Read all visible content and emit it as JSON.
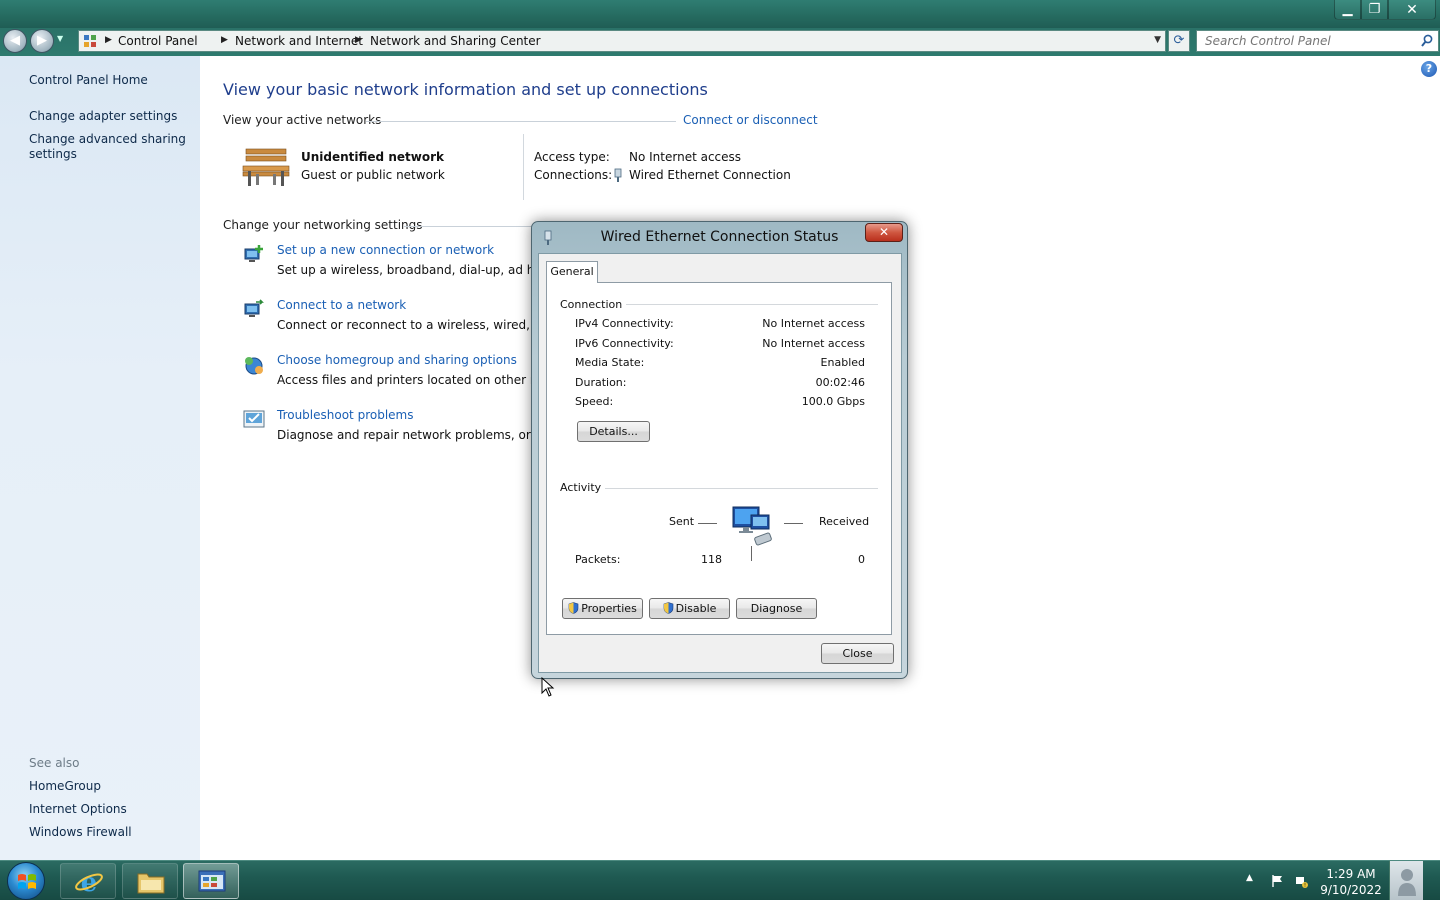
{
  "window": {
    "controls": {
      "minimize": "▁",
      "maximize": "❐",
      "close": "✕"
    }
  },
  "address_bar": {
    "breadcrumbs": [
      "Control Panel",
      "Network and Internet",
      "Network and Sharing Center"
    ],
    "search_placeholder": "Search Control Panel"
  },
  "left_pane": {
    "home_link": "Control Panel Home",
    "links": [
      "Change adapter settings",
      "Change advanced sharing settings"
    ],
    "see_also_label": "See also",
    "see_also_links": [
      "HomeGroup",
      "Internet Options",
      "Windows Firewall"
    ]
  },
  "main": {
    "heading": "View your basic network information and set up connections",
    "active_networks_label": "View your active networks",
    "connect_disconnect_link": "Connect or disconnect",
    "network": {
      "name": "Unidentified network",
      "type": "Guest or public network",
      "access_type_label": "Access type:",
      "access_type_value": "No Internet access",
      "connections_label": "Connections:",
      "connections_value": "Wired Ethernet Connection"
    },
    "settings_label": "Change your networking settings",
    "tasks": [
      {
        "title": "Set up a new connection or network",
        "desc": "Set up a wireless, broadband, dial-up, ad hoc, or V"
      },
      {
        "title": "Connect to a network",
        "desc": "Connect or reconnect to a wireless, wired, dial-up"
      },
      {
        "title": "Choose homegroup and sharing options",
        "desc": "Access files and printers located on other network"
      },
      {
        "title": "Troubleshoot problems",
        "desc": "Diagnose and repair network problems, or get tro"
      }
    ]
  },
  "dialog": {
    "title": "Wired Ethernet Connection Status",
    "close_glyph": "✕",
    "tab": "General",
    "connection_group": "Connection",
    "fields": [
      {
        "label": "IPv4 Connectivity:",
        "value": "No Internet access"
      },
      {
        "label": "IPv6 Connectivity:",
        "value": "No Internet access"
      },
      {
        "label": "Media State:",
        "value": "Enabled"
      },
      {
        "label": "Duration:",
        "value": "00:02:46"
      },
      {
        "label": "Speed:",
        "value": "100.0 Gbps"
      }
    ],
    "details_button": "Details...",
    "activity_group": "Activity",
    "sent_label": "Sent",
    "received_label": "Received",
    "packets_label": "Packets:",
    "packets_sent": "118",
    "packets_received": "0",
    "buttons": {
      "properties": "Properties",
      "disable": "Disable",
      "diagnose": "Diagnose"
    },
    "close_button": "Close"
  },
  "taskbar": {
    "time": "1:29 AM",
    "date": "9/10/2022",
    "tray_arrow": "▲"
  },
  "colors": {
    "titlebar": "#256a5f",
    "link": "#1a5fb4",
    "heading": "#1f3e8c",
    "left_pane": "#e3edf7"
  }
}
